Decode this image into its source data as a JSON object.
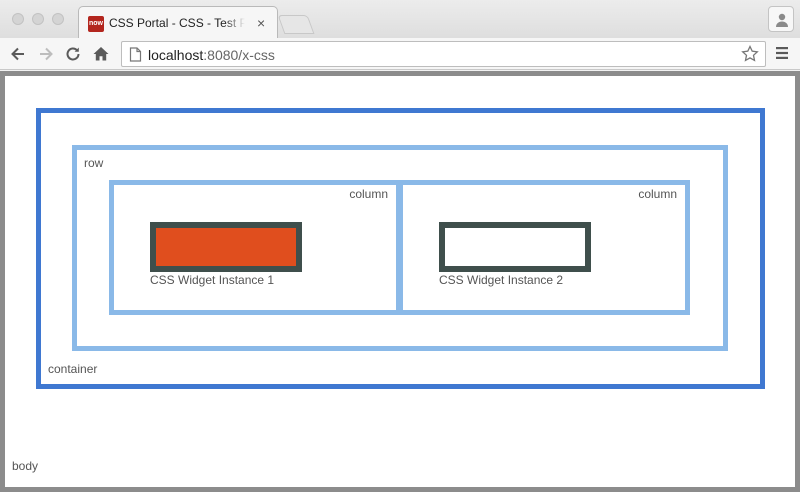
{
  "browser": {
    "tab": {
      "favicon_text": "now",
      "title": "CSS Portal - CSS - Test Page",
      "close_glyph": "×"
    },
    "address_bar": {
      "host": "localhost",
      "path": ":8080/x-css"
    },
    "icons": [
      "back-icon",
      "forward-icon",
      "reload-icon",
      "home-icon",
      "page-icon",
      "bookmark-star-icon",
      "menu-icon",
      "profile-icon"
    ]
  },
  "page": {
    "body_label": "body",
    "container_label": "container",
    "row_label": "row",
    "columns": [
      {
        "label": "column",
        "widget_label": "CSS Widget Instance 1",
        "widget_color": "#e04e1e"
      },
      {
        "label": "column",
        "widget_label": "CSS Widget Instance 2",
        "widget_color": "#ffffff"
      }
    ]
  },
  "colors": {
    "container_border": "#3f78d1",
    "row_column_border": "#8ab9e8",
    "widget_border": "#3f4f4c",
    "favicon_bg": "#b3261e"
  }
}
